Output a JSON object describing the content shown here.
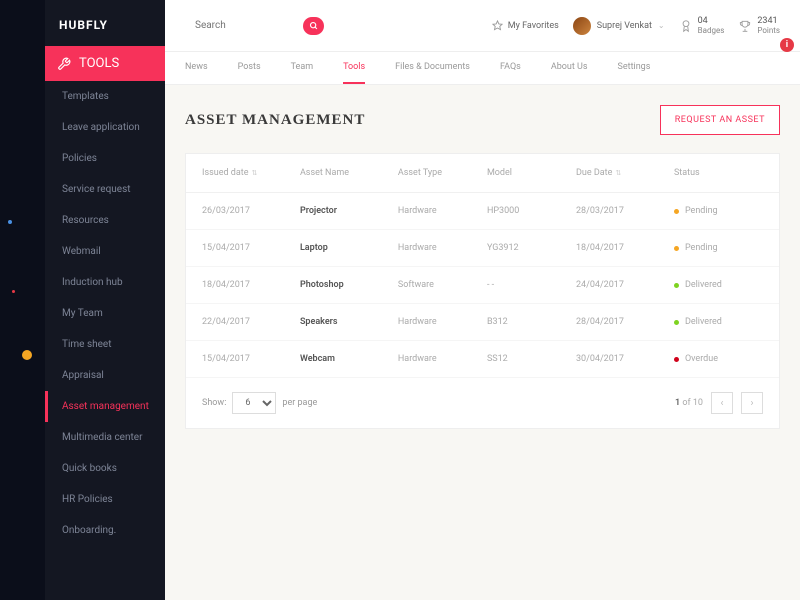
{
  "brand": "HUBFLY",
  "search": {
    "placeholder": "Search"
  },
  "favorites_label": "My Favorites",
  "user": {
    "name": "Suprej Venkat"
  },
  "badges": {
    "count": "04",
    "label": "Badges"
  },
  "points": {
    "count": "2341",
    "label": "Points"
  },
  "tools_header": "TOOLS",
  "sidebar": {
    "items": [
      {
        "label": "Templates"
      },
      {
        "label": "Leave application"
      },
      {
        "label": "Policies"
      },
      {
        "label": "Service request"
      },
      {
        "label": "Resources"
      },
      {
        "label": "Webmail"
      },
      {
        "label": "Induction hub"
      },
      {
        "label": "My Team"
      },
      {
        "label": "Time sheet"
      },
      {
        "label": "Appraisal"
      },
      {
        "label": "Asset management"
      },
      {
        "label": "Multimedia center"
      },
      {
        "label": "Quick books"
      },
      {
        "label": "HR Policies"
      },
      {
        "label": "Onboarding."
      }
    ]
  },
  "tabs": [
    {
      "label": "News"
    },
    {
      "label": "Posts"
    },
    {
      "label": "Team"
    },
    {
      "label": "Tools"
    },
    {
      "label": "Files & Documents"
    },
    {
      "label": "FAQs"
    },
    {
      "label": "About Us"
    },
    {
      "label": "Settings"
    }
  ],
  "page_title": "ASSET MANAGEMENT",
  "request_btn": "REQUEST AN ASSET",
  "columns": {
    "issued": "Issued date",
    "name": "Asset Name",
    "type": "Asset Type",
    "model": "Model",
    "due": "Due Date",
    "status": "Status"
  },
  "rows": [
    {
      "issued": "26/03/2017",
      "name": "Projector",
      "type": "Hardware",
      "model": "HP3000",
      "due": "28/03/2017",
      "status": "Pending",
      "statusClass": "pending"
    },
    {
      "issued": "15/04/2017",
      "name": "Laptop",
      "type": "Hardware",
      "model": "YG3912",
      "due": "18/04/2017",
      "status": "Pending",
      "statusClass": "pending"
    },
    {
      "issued": "18/04/2017",
      "name": "Photoshop",
      "type": "Software",
      "model": "- -",
      "due": "24/04/2017",
      "status": "Delivered",
      "statusClass": "delivered"
    },
    {
      "issued": "22/04/2017",
      "name": "Speakers",
      "type": "Hardware",
      "model": "B312",
      "due": "28/04/2017",
      "status": "Delivered",
      "statusClass": "delivered"
    },
    {
      "issued": "15/04/2017",
      "name": "Webcam",
      "type": "Hardware",
      "model": "SS12",
      "due": "30/04/2017",
      "status": "Overdue",
      "statusClass": "overdue"
    }
  ],
  "pager": {
    "show": "Show:",
    "per_page_value": "6",
    "per_page": "per page",
    "current": "1",
    "of": "of 10"
  }
}
